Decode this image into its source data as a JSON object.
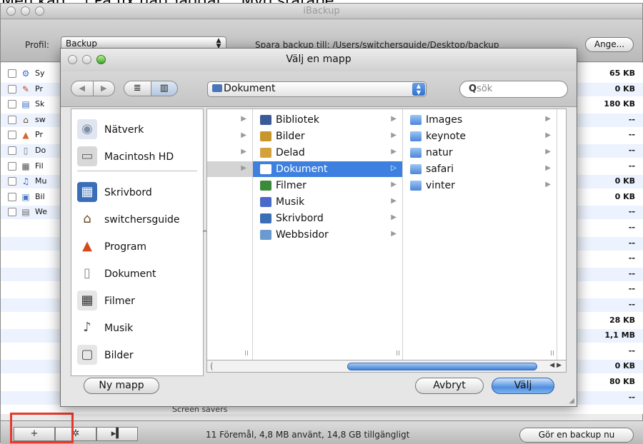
{
  "caption": "Mén kap... | På fix hatt laggat... Myd statape",
  "main_window": {
    "title": "iBackup",
    "profile_label": "Profil:",
    "profile_value": "Backup",
    "save_path": "Spara backup till: /Users/switchersguide/Desktop/backup",
    "ange_label": "Ange...",
    "rows": [
      {
        "icon": "system-prefs-icon",
        "name": "Sy",
        "size": "65 KB"
      },
      {
        "icon": "app-icon",
        "name": "Pr",
        "size": "0 KB"
      },
      {
        "icon": "desktop-icon",
        "name": "Sk",
        "size": "180 KB"
      },
      {
        "icon": "home-icon",
        "name": "sw",
        "size": "--"
      },
      {
        "icon": "programs-icon",
        "name": "Pr",
        "size": "--"
      },
      {
        "icon": "document-icon",
        "name": "Do",
        "size": "--"
      },
      {
        "icon": "film-icon",
        "name": "Fil",
        "size": "--"
      },
      {
        "icon": "music-icon",
        "name": "Mu",
        "size": "0 KB"
      },
      {
        "icon": "pictures-icon",
        "name": "Bil",
        "size": "0 KB"
      },
      {
        "icon": "sites-icon",
        "name": "We",
        "size": "--"
      },
      {
        "icon": "",
        "name": "",
        "size": "--"
      },
      {
        "icon": "",
        "name": "",
        "size": "--"
      },
      {
        "icon": "",
        "name": "",
        "size": "--"
      },
      {
        "icon": "",
        "name": "",
        "size": "--"
      },
      {
        "icon": "",
        "name": "",
        "size": "--"
      },
      {
        "icon": "",
        "name": "",
        "size": "--"
      },
      {
        "icon": "",
        "name": "",
        "size": "28 KB"
      },
      {
        "icon": "",
        "name": "",
        "size": "1,1 MB"
      },
      {
        "icon": "",
        "name": "",
        "size": "--"
      },
      {
        "icon": "",
        "name": "",
        "size": "0 KB"
      },
      {
        "icon": "",
        "name": "",
        "size": "80 KB"
      },
      {
        "icon": "",
        "name": "",
        "size": "--"
      }
    ],
    "hidden_row_text": "Screen savers",
    "status": "11 Föremål, 4,8 MB använt, 14,8 GB tillgängligt",
    "backup_now_label": "Gör en backup nu",
    "bottom_buttons": [
      "+",
      "✲",
      "▸▍"
    ]
  },
  "dialog": {
    "title": "Välj en mapp",
    "location": "Dokument",
    "search_placeholder": "sök",
    "sidebar": [
      {
        "label": "Nätverk",
        "icon": "network-icon"
      },
      {
        "label": "Macintosh HD",
        "icon": "harddisk-icon"
      },
      {
        "label": "Skrivbord",
        "icon": "desktop-icon"
      },
      {
        "label": "switchersguide",
        "icon": "home-icon"
      },
      {
        "label": "Program",
        "icon": "applications-icon"
      },
      {
        "label": "Dokument",
        "icon": "documents-icon"
      },
      {
        "label": "Filmer",
        "icon": "movies-icon"
      },
      {
        "label": "Musik",
        "icon": "music-icon"
      },
      {
        "label": "Bilder",
        "icon": "pictures-icon"
      }
    ],
    "column2": [
      {
        "label": "Bibliotek",
        "selected": false
      },
      {
        "label": "Bilder",
        "selected": false
      },
      {
        "label": "Delad",
        "selected": false
      },
      {
        "label": "Dokument",
        "selected": true
      },
      {
        "label": "Filmer",
        "selected": false
      },
      {
        "label": "Musik",
        "selected": false
      },
      {
        "label": "Skrivbord",
        "selected": false
      },
      {
        "label": "Webbsidor",
        "selected": false
      }
    ],
    "column3": [
      {
        "label": "Images"
      },
      {
        "label": "keynote"
      },
      {
        "label": "natur"
      },
      {
        "label": "safari"
      },
      {
        "label": "vinter"
      }
    ],
    "new_folder_label": "Ny mapp",
    "cancel_label": "Avbryt",
    "choose_label": "Välj"
  },
  "colors": {
    "selection": "#3d80df",
    "highlight_box": "#e8392c",
    "default_button": "#4f8fe0"
  }
}
